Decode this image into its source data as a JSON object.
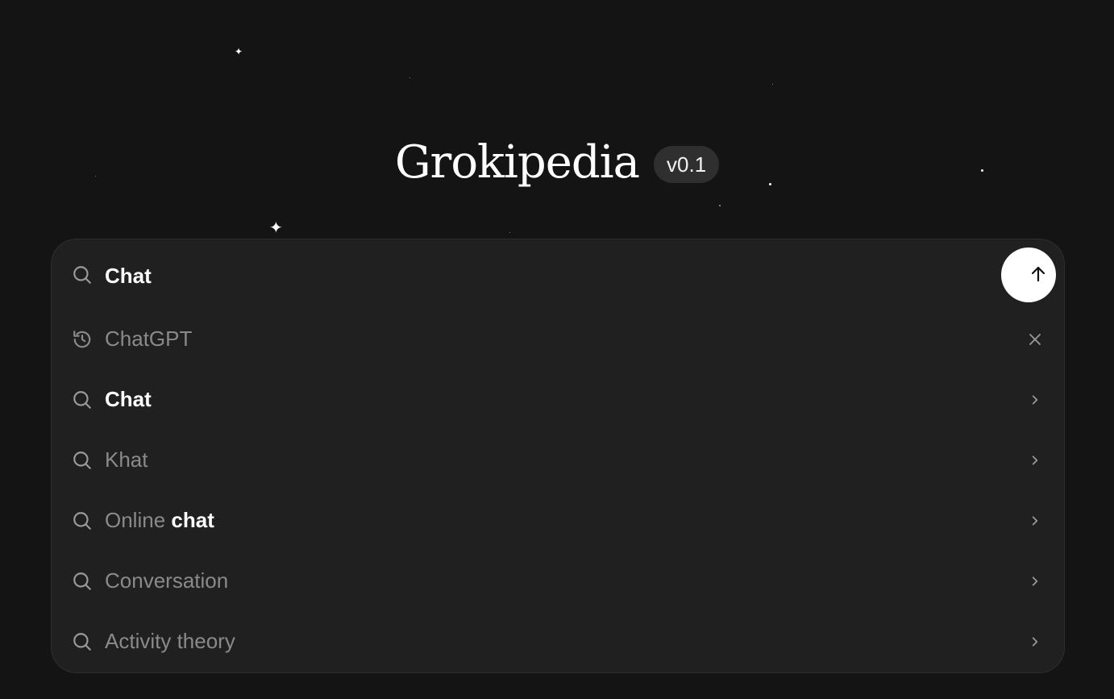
{
  "app": {
    "title": "Grokipedia",
    "version": "v0.1"
  },
  "search": {
    "value": "Chat",
    "icon": "search-icon",
    "submit_icon": "arrow-up-icon"
  },
  "suggestions": [
    {
      "type": "history",
      "icon": "history-icon",
      "text_plain": "ChatGPT",
      "text_highlight": "",
      "trailing_icon": "close-icon"
    },
    {
      "type": "search",
      "icon": "search-icon",
      "text_plain": "",
      "text_highlight": "Chat",
      "trailing_icon": "chevron-right-icon"
    },
    {
      "type": "search",
      "icon": "search-icon",
      "text_plain": "Khat",
      "text_highlight": "",
      "trailing_icon": "chevron-right-icon"
    },
    {
      "type": "search",
      "icon": "search-icon",
      "text_plain": "Online ",
      "text_highlight": "chat",
      "trailing_icon": "chevron-right-icon"
    },
    {
      "type": "search",
      "icon": "search-icon",
      "text_plain": "Conversation",
      "text_highlight": "",
      "trailing_icon": "chevron-right-icon"
    },
    {
      "type": "search",
      "icon": "search-icon",
      "text_plain": "Activity theory",
      "text_highlight": "",
      "trailing_icon": "chevron-right-icon"
    }
  ],
  "colors": {
    "background": "#141414",
    "panel": "#202020",
    "text_primary": "#ffffff",
    "text_muted": "#8a8a8a"
  }
}
